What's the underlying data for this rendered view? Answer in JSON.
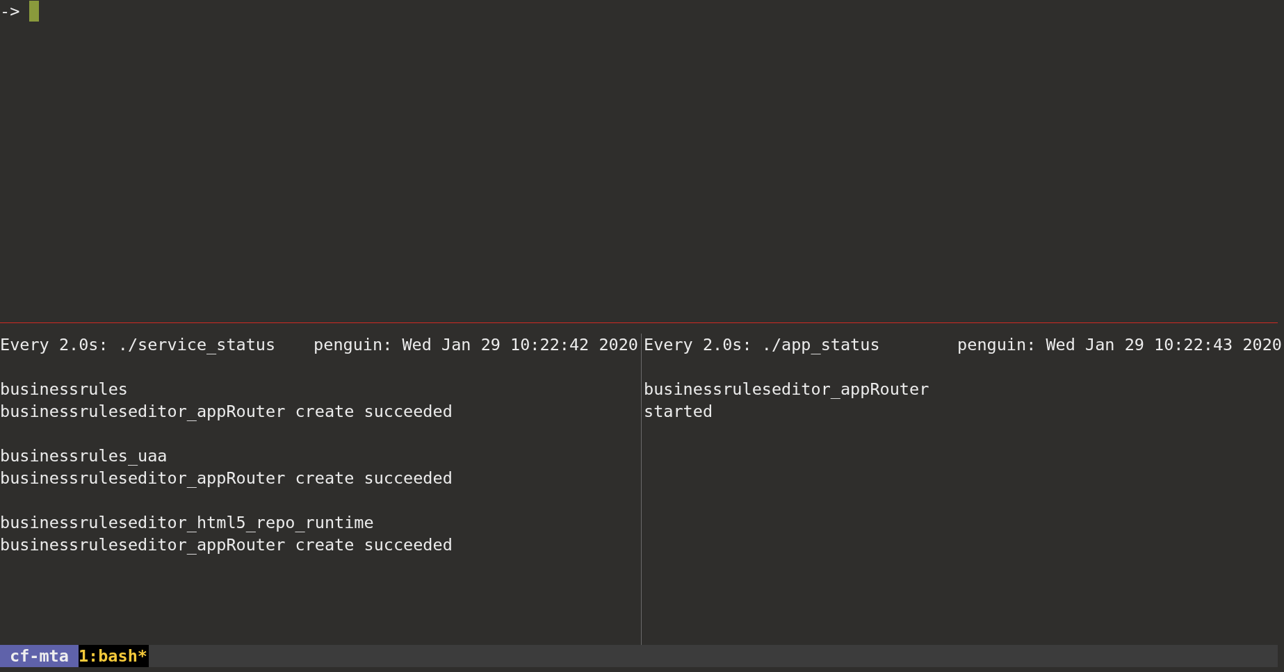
{
  "top_pane": {
    "prompt": "->"
  },
  "panes": [
    {
      "command": "Every 2.0s: ./service_status",
      "host_time": "penguin: Wed Jan 29 10:22:42 2020",
      "entries": [
        {
          "name": "businessrules",
          "status": "businessruleseditor_appRouter create succeeded"
        },
        {
          "name": "businessrules_uaa",
          "status": "businessruleseditor_appRouter create succeeded"
        },
        {
          "name": "businessruleseditor_html5_repo_runtime",
          "status": "businessruleseditor_appRouter create succeeded"
        }
      ]
    },
    {
      "command": "Every 2.0s: ./app_status",
      "host_time": "penguin: Wed Jan 29 10:22:43 2020",
      "entries": [
        {
          "name": "businessruleseditor_appRouter",
          "status": "started"
        }
      ]
    }
  ],
  "status_bar": {
    "session": "cf-mta",
    "windows": [
      {
        "label": "1:bash*",
        "selected": true
      }
    ]
  }
}
